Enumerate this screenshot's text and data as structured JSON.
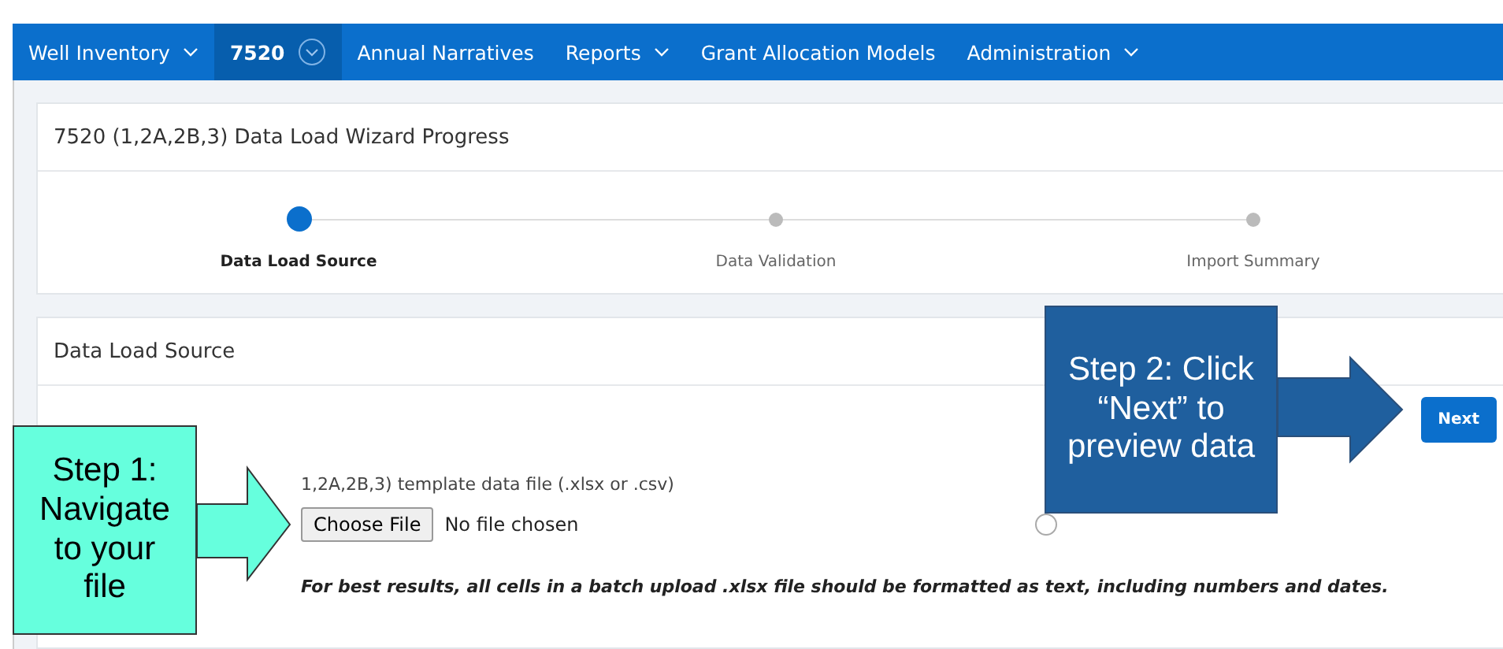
{
  "nav": [
    {
      "label": "Well Inventory",
      "selected": false,
      "dropdown": true
    },
    {
      "label": "7520",
      "selected": true,
      "dropdown": true
    },
    {
      "label": "Annual Narratives",
      "selected": false,
      "dropdown": false
    },
    {
      "label": "Reports",
      "selected": false,
      "dropdown": true
    },
    {
      "label": "Grant Allocation Models",
      "selected": false,
      "dropdown": false
    },
    {
      "label": "Administration",
      "selected": false,
      "dropdown": true
    }
  ],
  "progress": {
    "title": "7520 (1,2A,2B,3) Data Load Wizard Progress",
    "steps": [
      {
        "label": "Data Load Source",
        "selected": true
      },
      {
        "label": "Data Validation",
        "selected": false
      },
      {
        "label": "Import Summary",
        "selected": false
      }
    ]
  },
  "source": {
    "title": "Data Load Source",
    "next_button": "Next",
    "file_label": "1,2A,2B,3) template data file (.xlsx or .csv)",
    "choose_button": "Choose File",
    "file_status": "No file chosen",
    "note": "For best results, all cells in a batch upload .xlsx file should be formatted as text, including numbers and dates."
  },
  "callouts": [
    {
      "text": "Step 1: Navigate to your file",
      "color": "#66ffdd"
    },
    {
      "text": "Step 2: Click “Next” to preview data",
      "color": "#1f5f9e"
    }
  ]
}
